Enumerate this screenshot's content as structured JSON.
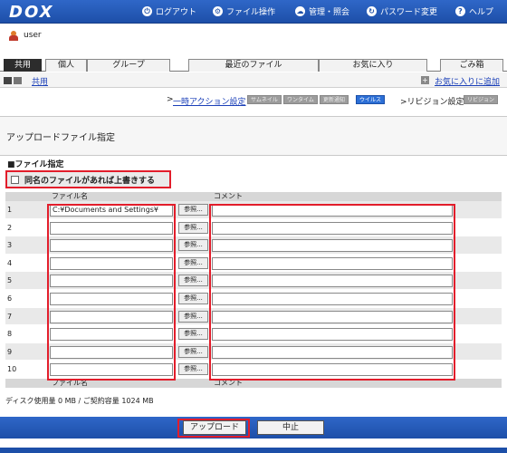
{
  "header": {
    "logo": "DOX",
    "nav": [
      {
        "label": "ログアウト",
        "icon": "logout-icon",
        "glyph": "⏻"
      },
      {
        "label": "ファイル操作",
        "icon": "file-operation-icon",
        "glyph": "⚙"
      },
      {
        "label": "管理・照会",
        "icon": "admin-icon",
        "glyph": "☁"
      },
      {
        "label": "パスワード変更",
        "icon": "password-icon",
        "glyph": "↻"
      },
      {
        "label": "ヘルプ",
        "icon": "help-icon",
        "glyph": "?"
      }
    ]
  },
  "user": {
    "name": "user"
  },
  "tabs": {
    "shared": "共用",
    "personal": "個人",
    "group": "グループ",
    "recent": "最近のファイル",
    "favorites": "お気に入り",
    "trash": "ごみ箱"
  },
  "subbar": {
    "breadcrumb": "共用",
    "add_favorite": "お気に入りに追加"
  },
  "options": {
    "action_prefix": ">",
    "action_link": "一時アクション設定",
    "buttons": [
      "サムネイル",
      "ワンタイム",
      "更新通知",
      "ウイルス"
    ],
    "revision_label": ">リビジョン設定",
    "revision_button": "リビジョン"
  },
  "panel": {
    "title": "アップロードファイル指定",
    "section": "■ファイル指定",
    "overwrite_label": "同名のファイルがあれば上書きする"
  },
  "table": {
    "col_file": "ファイル名",
    "col_comment": "コメント",
    "browse_label": "参照...",
    "rows": [
      {
        "no": "1",
        "file": "C:¥Documents and Settings¥",
        "comment": ""
      },
      {
        "no": "2",
        "file": "",
        "comment": ""
      },
      {
        "no": "3",
        "file": "",
        "comment": ""
      },
      {
        "no": "4",
        "file": "",
        "comment": ""
      },
      {
        "no": "5",
        "file": "",
        "comment": ""
      },
      {
        "no": "6",
        "file": "",
        "comment": ""
      },
      {
        "no": "7",
        "file": "",
        "comment": ""
      },
      {
        "no": "8",
        "file": "",
        "comment": ""
      },
      {
        "no": "9",
        "file": "",
        "comment": ""
      },
      {
        "no": "10",
        "file": "",
        "comment": ""
      }
    ]
  },
  "disk": "ディスク使用量 0 MB / ご契約容量 1024 MB",
  "footer": {
    "upload_label": "アップロード",
    "cancel_label": "中止"
  },
  "colors": {
    "header_blue": "#1d4fa8",
    "highlight_red": "#e21d2b",
    "link_blue": "#1a3fb8"
  }
}
